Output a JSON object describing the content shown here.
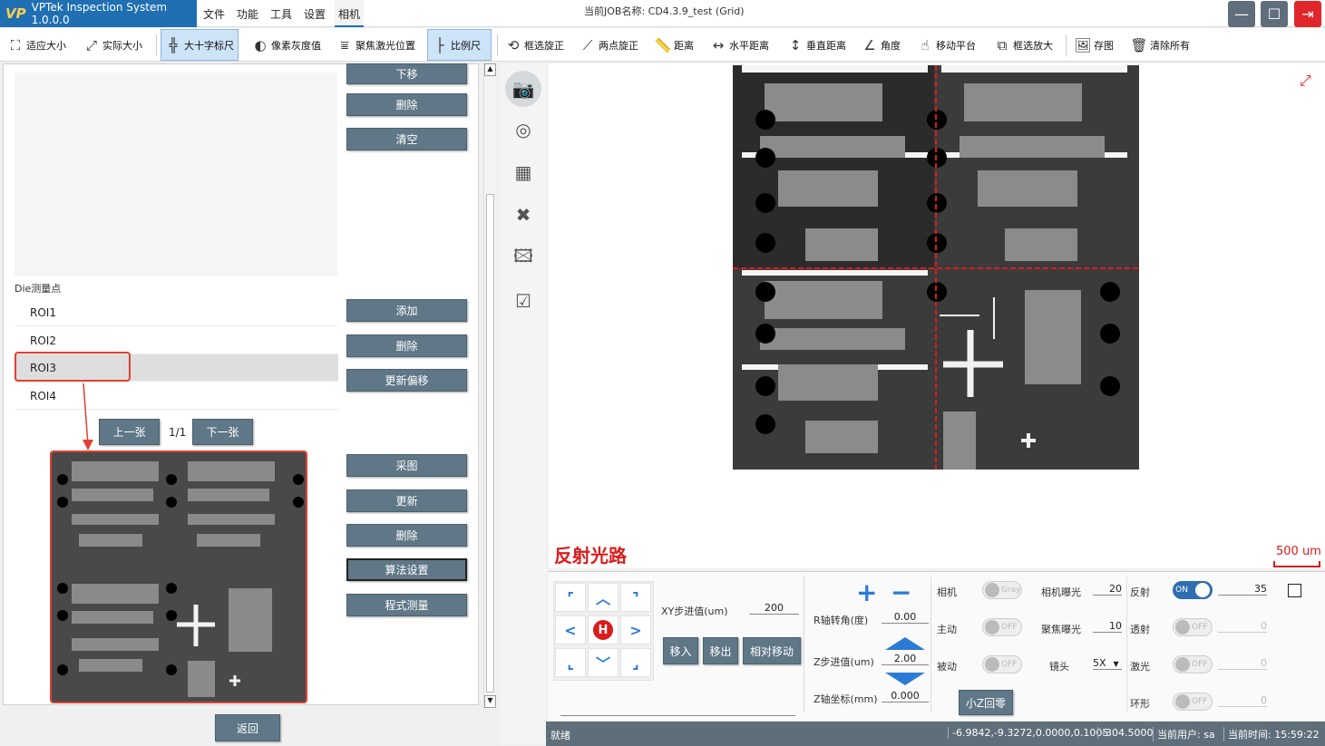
{
  "app": {
    "logo_mark": "VP",
    "title": "VPTek Inspection System 1.0.0.0"
  },
  "menu": [
    "文件",
    "功能",
    "工具",
    "设置",
    "相机"
  ],
  "job_title": "当前JOB名称:  CD4.3.9_test (Grid)",
  "window_buttons": {
    "minimize": "—",
    "maximize": "☐",
    "exit": "⇥"
  },
  "toolbar": [
    {
      "label": "适应大小",
      "icon": "fit-icon"
    },
    {
      "label": "实际大小",
      "icon": "actual-size-icon"
    },
    {
      "label": "大十字标尺",
      "icon": "crosshair-icon",
      "active": true
    },
    {
      "label": "像素灰度值",
      "icon": "gray-value-icon"
    },
    {
      "label": "聚焦激光位置",
      "icon": "laser-focus-icon"
    },
    {
      "label": "比例尺",
      "icon": "scale-bar-icon",
      "active": true
    },
    {
      "label": "框选旋正",
      "icon": "box-rotate-icon"
    },
    {
      "label": "两点旋正",
      "icon": "two-point-rotate-icon"
    },
    {
      "label": "距离",
      "icon": "ruler-icon"
    },
    {
      "label": "水平距离",
      "icon": "horizontal-distance-icon"
    },
    {
      "label": "垂直距离",
      "icon": "vertical-distance-icon"
    },
    {
      "label": "角度",
      "icon": "angle-icon"
    },
    {
      "label": "移动平台",
      "icon": "move-stage-icon"
    },
    {
      "label": "框选放大",
      "icon": "box-zoom-icon"
    },
    {
      "label": "存图",
      "icon": "save-image-icon"
    },
    {
      "label": "清除所有",
      "icon": "clear-all-icon"
    }
  ],
  "left": {
    "top_buttons": [
      "下移",
      "删除",
      "清空"
    ],
    "die_section_label": "Die测量点",
    "roi_items": [
      "ROI1",
      "ROI2",
      "ROI3",
      "ROI4"
    ],
    "selected_roi": "ROI3",
    "roi_buttons": [
      "添加",
      "删除",
      "更新偏移"
    ],
    "prev_label": "上一张",
    "page_indicator": "1/1",
    "next_label": "下一张",
    "image_buttons": [
      "采图",
      "更新",
      "删除",
      "算法设置",
      "程式测量"
    ],
    "back_label": "返回"
  },
  "viewer": {
    "light_path_label": "反射光路",
    "scale_label": "500 um",
    "expand_icon": "expand-icon"
  },
  "controls": {
    "xy_step_label": "XY步进值(um)",
    "xy_step_value": "200",
    "move_in": "移入",
    "move_out": "移出",
    "relative_move": "相对移动",
    "r_angle_label": "R轴转角(度)",
    "r_angle_value": "0.00",
    "z_step_label": "Z步进值(um)",
    "z_step_value": "2.00",
    "z_coord_label": "Z轴坐标(mm)",
    "z_coord_value": "0.000",
    "camera_label": "相机",
    "camera_toggle": "Gray",
    "active_label": "主动",
    "active_toggle": "OFF",
    "passive_label": "被动",
    "passive_toggle": "OFF",
    "z_home": "小Z回零",
    "cam_exposure_label": "相机曝光",
    "cam_exposure_value": "20",
    "focus_exposure_label": "聚焦曝光",
    "focus_exposure_value": "10",
    "lens_label": "镜头",
    "lens_value": "5X",
    "reflect_label": "反射",
    "reflect_toggle": "ON",
    "reflect_value": "35",
    "transmit_label": "透射",
    "transmit_toggle": "OFF",
    "transmit_value": "0",
    "laser_label": "激光",
    "laser_toggle": "OFF",
    "laser_value": "0",
    "ring_label": "环形",
    "ring_toggle": "OFF",
    "ring_value": "0"
  },
  "status": {
    "state": "就绪",
    "coords": "-6.9842,-9.3272,0.0000,0.1005",
    "z": "-304.5000",
    "user": "当前用户:  sa",
    "time": "当前时间:  15:59:22"
  },
  "colors": {
    "accent": "#1f6fb2",
    "button": "#5f7786",
    "highlight": "#e04030",
    "status": "#5e6e7a"
  }
}
